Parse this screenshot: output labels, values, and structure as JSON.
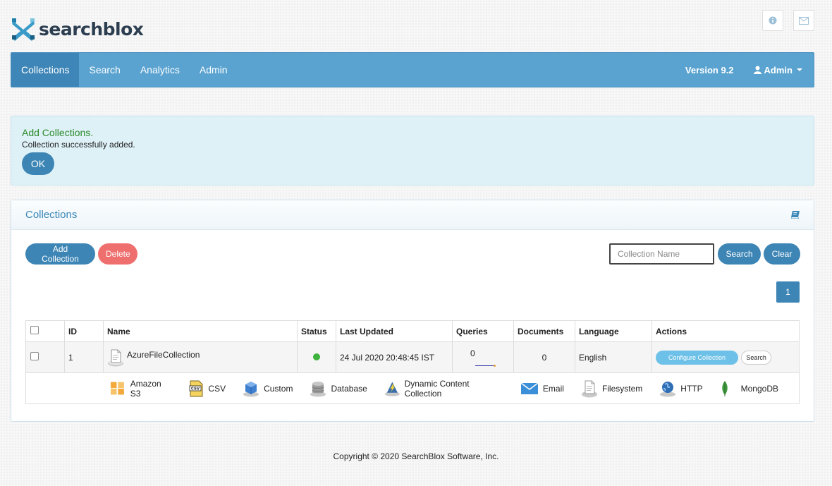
{
  "brand": {
    "name": "searchblox"
  },
  "top_icons": {
    "info": "info-icon",
    "mail": "envelope-icon"
  },
  "nav": {
    "items": [
      {
        "label": "Collections",
        "active": true
      },
      {
        "label": "Search"
      },
      {
        "label": "Analytics"
      },
      {
        "label": "Admin"
      }
    ],
    "version": "Version 9.2",
    "user_label": "Admin"
  },
  "alert": {
    "title": "Add Collections.",
    "message": "Collection successfully added.",
    "ok_label": "OK"
  },
  "panel": {
    "title": "Collections",
    "add_label": "Add Collection",
    "delete_label": "Delete",
    "search_placeholder": "Collection Name",
    "search_label": "Search",
    "clear_label": "Clear",
    "page": "1"
  },
  "table": {
    "headers": {
      "id": "ID",
      "name": "Name",
      "status": "Status",
      "last_updated": "Last Updated",
      "queries": "Queries",
      "documents": "Documents",
      "language": "Language",
      "actions": "Actions"
    },
    "rows": [
      {
        "id": "1",
        "name": "AzureFileCollection",
        "status": "active",
        "last_updated": "24 Jul 2020 20:48:45 IST",
        "queries": "0",
        "documents": "0",
        "language": "English",
        "configure_label": "Configure Collection",
        "search_label": "Search"
      }
    ]
  },
  "collection_types": [
    "Amazon S3",
    "CSV",
    "Custom",
    "Database",
    "Dynamic Content Collection",
    "Email",
    "Filesystem",
    "HTTP",
    "MongoDB"
  ],
  "colors": {
    "navbar": "#5aa3d0",
    "accent": "#3d85b5",
    "danger": "#ef6e6e",
    "success": "#3db33d"
  },
  "footer": "Copyright © 2020 SearchBlox Software, Inc."
}
